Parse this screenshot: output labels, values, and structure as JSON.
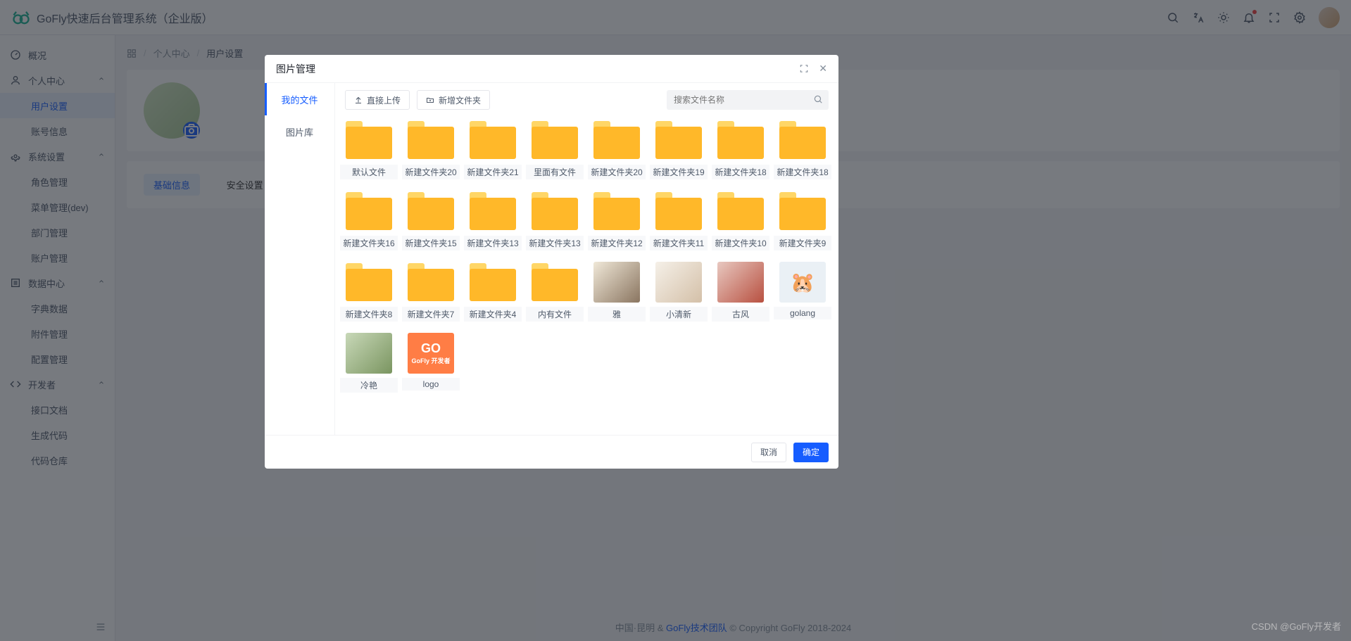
{
  "header": {
    "title": "GoFly快速后台管理系统（企业版）"
  },
  "sidebar": {
    "items": [
      {
        "label": "概况",
        "icon": "dashboard"
      },
      {
        "label": "个人中心",
        "icon": "user",
        "expand": true
      },
      {
        "label": "用户设置",
        "sub": true,
        "active": true
      },
      {
        "label": "账号信息",
        "sub": true
      },
      {
        "label": "系统设置",
        "icon": "settings",
        "expand": true
      },
      {
        "label": "角色管理",
        "sub": true
      },
      {
        "label": "菜单管理(dev)",
        "sub": true
      },
      {
        "label": "部门管理",
        "sub": true
      },
      {
        "label": "账户管理",
        "sub": true
      },
      {
        "label": "数据中心",
        "icon": "list",
        "expand": true
      },
      {
        "label": "字典数据",
        "sub": true
      },
      {
        "label": "附件管理",
        "sub": true
      },
      {
        "label": "配置管理",
        "sub": true
      },
      {
        "label": "开发者",
        "icon": "code",
        "expand": true
      },
      {
        "label": "接口文档",
        "sub": true
      },
      {
        "label": "生成代码",
        "sub": true
      },
      {
        "label": "代码仓库",
        "sub": true
      }
    ]
  },
  "breadcrumb": {
    "home_icon": "apps",
    "items": [
      "个人中心",
      "用户设置"
    ]
  },
  "tabs": {
    "basic": "基础信息",
    "security": "安全设置"
  },
  "modal": {
    "title": "图片管理",
    "side_tabs": {
      "my_files": "我的文件",
      "gallery": "图片库"
    },
    "toolbar": {
      "upload": "直接上传",
      "new_folder": "新增文件夹"
    },
    "search_placeholder": "搜索文件名称",
    "items": [
      {
        "type": "folder",
        "label": "默认文件"
      },
      {
        "type": "folder",
        "label": "新建文件夹20"
      },
      {
        "type": "folder",
        "label": "新建文件夹21"
      },
      {
        "type": "folder",
        "label": "里面有文件"
      },
      {
        "type": "folder",
        "label": "新建文件夹20"
      },
      {
        "type": "folder",
        "label": "新建文件夹19"
      },
      {
        "type": "folder",
        "label": "新建文件夹18"
      },
      {
        "type": "folder",
        "label": "新建文件夹18"
      },
      {
        "type": "folder",
        "label": "新建文件夹16"
      },
      {
        "type": "folder",
        "label": "新建文件夹15"
      },
      {
        "type": "folder",
        "label": "新建文件夹13"
      },
      {
        "type": "folder",
        "label": "新建文件夹13"
      },
      {
        "type": "folder",
        "label": "新建文件夹12"
      },
      {
        "type": "folder",
        "label": "新建文件夹11"
      },
      {
        "type": "folder",
        "label": "新建文件夹10"
      },
      {
        "type": "folder",
        "label": "新建文件夹9"
      },
      {
        "type": "folder",
        "label": "新建文件夹8"
      },
      {
        "type": "folder",
        "label": "新建文件夹7"
      },
      {
        "type": "folder",
        "label": "新建文件夹4"
      },
      {
        "type": "folder",
        "label": "内有文件"
      },
      {
        "type": "image",
        "label": "雅",
        "cls": "img-ya"
      },
      {
        "type": "image",
        "label": "小清新",
        "cls": "img-xqs"
      },
      {
        "type": "image",
        "label": "古风",
        "cls": "img-gf"
      },
      {
        "type": "image",
        "label": "golang",
        "cls": "img-golang",
        "glyph": "🐹"
      },
      {
        "type": "image",
        "label": "冷艳",
        "cls": "img-ly"
      },
      {
        "type": "image",
        "label": "logo",
        "cls": "img-logo"
      }
    ],
    "footer": {
      "cancel": "取消",
      "confirm": "确定"
    }
  },
  "footer": {
    "loc": "中国·昆明",
    "amp": "&",
    "team": "GoFly技术团队",
    "copy": "© Copyright GoFly 2018-2024"
  },
  "watermark": "CSDN @GoFly开发者"
}
